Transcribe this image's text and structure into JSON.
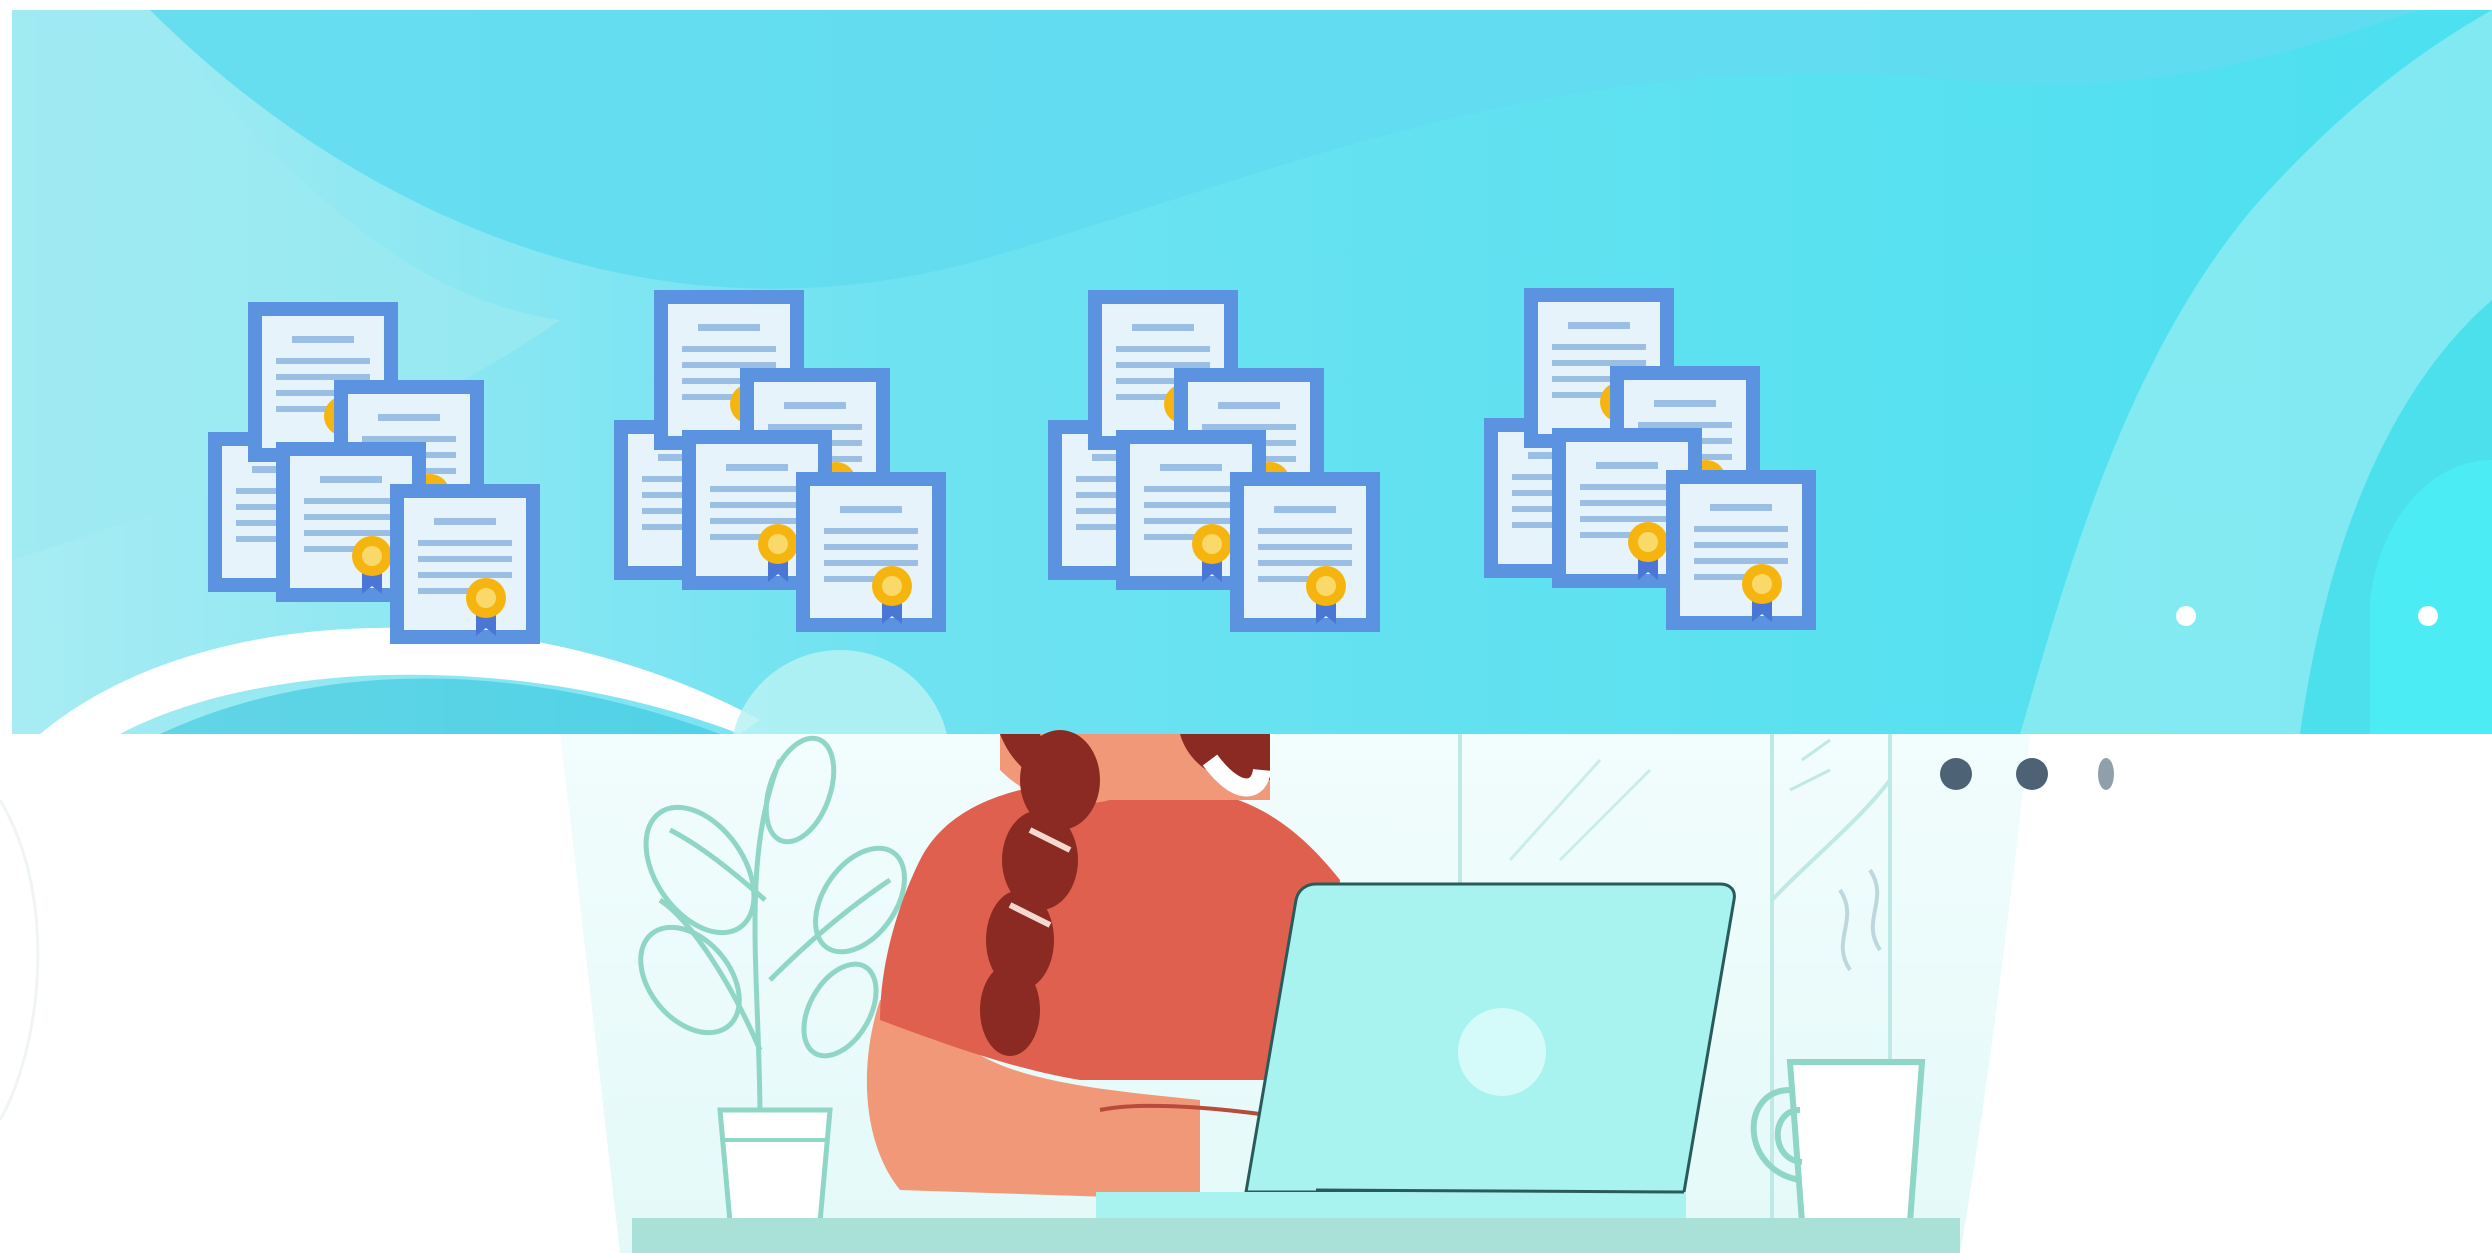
{
  "scene": {
    "top_panel": {
      "certificate_groups": [
        {
          "label": ""
        },
        {
          "label": ""
        },
        {
          "label": ""
        },
        {
          "label": ""
        }
      ]
    },
    "bottom_panel": {
      "carousel_dots": [
        {
          "state": "inactive"
        },
        {
          "state": "inactive"
        },
        {
          "state": "active"
        }
      ]
    },
    "colors": {
      "sky": "#5ee3f3",
      "cert_border": "#5c93e1",
      "cert_paper": "#e6f3fb",
      "seal": "#f6b40e",
      "shirt": "#e0604f",
      "hair": "#8b2a22",
      "skin": "#f19878",
      "laptop": "#a8f2ef",
      "plant_line": "#8fd6c6",
      "desk": "#a9e0d8",
      "dot": "#4d6375"
    }
  }
}
